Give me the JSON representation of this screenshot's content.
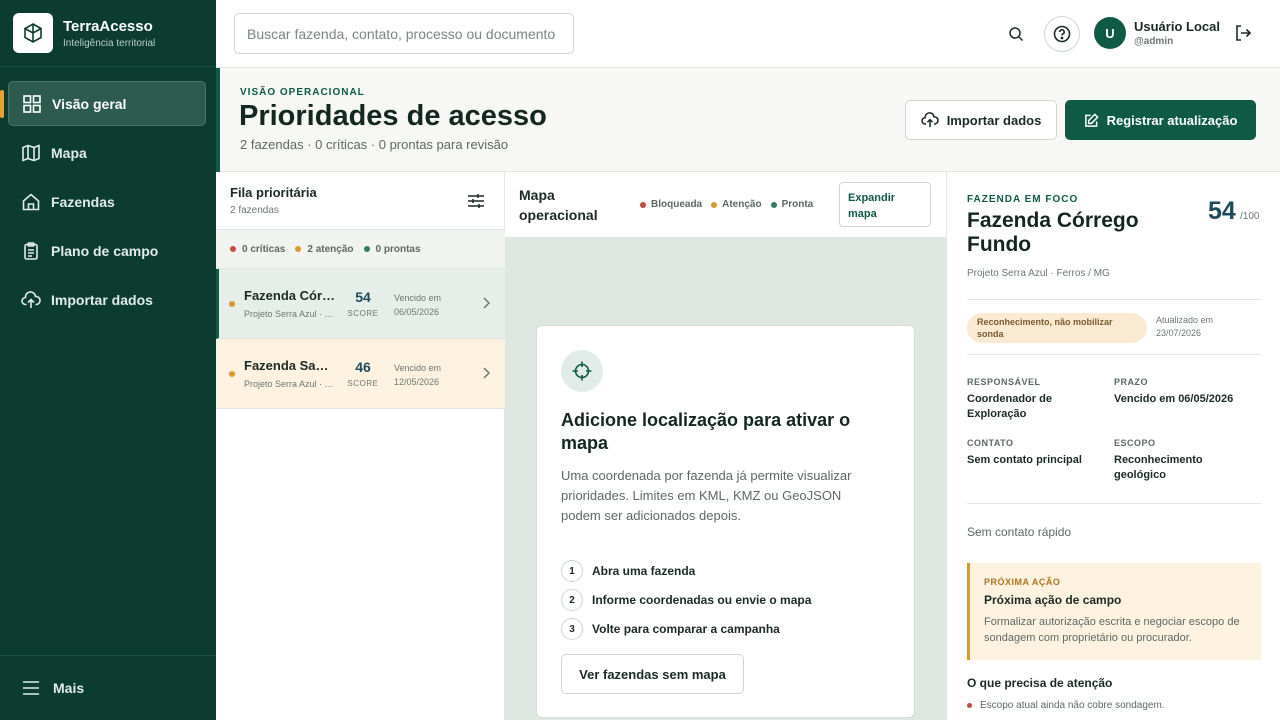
{
  "brand": {
    "name": "TerraAcesso",
    "subtitle": "Inteligência territorial"
  },
  "sidebar": {
    "items": [
      {
        "label": "Visão geral",
        "icon": "dashboard-icon",
        "active": true
      },
      {
        "label": "Mapa",
        "icon": "map-icon"
      },
      {
        "label": "Fazendas",
        "icon": "home-icon"
      },
      {
        "label": "Plano de campo",
        "icon": "clipboard-icon"
      },
      {
        "label": "Importar dados",
        "icon": "cloud-upload-icon"
      }
    ],
    "more_label": "Mais"
  },
  "topbar": {
    "search_placeholder": "Buscar fazenda, contato, processo ou documento",
    "avatar_initial": "U",
    "user_name": "Usuário Local",
    "user_handle": "@admin"
  },
  "header": {
    "eyebrow": "VISÃO OPERACIONAL",
    "title": "Prioridades de acesso",
    "subtitle": "2 fazendas · 0 críticas · 0 prontas para revisão",
    "import_label": "Importar dados",
    "register_label": "Registrar atualização"
  },
  "queue": {
    "title": "Fila prioritária",
    "count": "2 fazendas",
    "stats": [
      {
        "label": "0 críticas",
        "color": "#c9473d"
      },
      {
        "label": "2 atenção",
        "color": "#d9992f"
      },
      {
        "label": "0 prontas",
        "color": "#2f7d5b"
      }
    ],
    "rows": [
      {
        "name": "Fazenda Córrego Fundo",
        "project": "Projeto Serra Azul · Ferros / MG",
        "score": "54",
        "score_label": "SCORE",
        "due_label": "Vencido em",
        "due_date": "06/05/2026",
        "status_color": "#d9992f"
      },
      {
        "name": "Fazenda Santa Rita",
        "project": "Projeto Serra Azul · Ferros / MG",
        "score": "46",
        "score_label": "SCORE",
        "due_label": "Vencido em",
        "due_date": "12/05/2026",
        "status_color": "#d9992f"
      }
    ]
  },
  "map": {
    "title": "Mapa operacional",
    "legend": [
      {
        "label": "Bloqueada",
        "color": "#c9473d"
      },
      {
        "label": "Atenção",
        "color": "#d9992f"
      },
      {
        "label": "Pronta",
        "color": "#2f7d5b"
      }
    ],
    "expand_label": "Expandir mapa",
    "card": {
      "title": "Adicione localização para ativar o mapa",
      "text": "Uma coordenada por fazenda já permite visualizar prioridades. Limites em KML, KMZ ou GeoJSON podem ser adicionados depois.",
      "steps": [
        {
          "num": "1",
          "label": "Abra uma fazenda"
        },
        {
          "num": "2",
          "label": "Informe coordenadas ou envie o mapa"
        },
        {
          "num": "3",
          "label": "Volte para comparar a campanha"
        }
      ],
      "button_label": "Ver fazendas sem mapa"
    }
  },
  "detail": {
    "eyebrow": "FAZENDA EM FOCO",
    "title": "Fazenda Córrego Fundo",
    "score": "54",
    "score_max": "/100",
    "location": "Projeto Serra Azul · Ferros / MG",
    "badge": "Reconhecimento, não mobilizar sonda",
    "updated_label": "Atualizado em",
    "updated_date": "23/07/2026",
    "fields": {
      "responsavel_label": "RESPONSÁVEL",
      "responsavel_value": "Coordenador de Exploração",
      "prazo_label": "PRAZO",
      "prazo_value": "Vencido em 06/05/2026",
      "contato_label": "CONTATO",
      "contato_value": "Sem contato principal",
      "escopo_label": "ESCOPO",
      "escopo_value": "Reconhecimento geológico"
    },
    "quick_contact": "Sem contato rápido",
    "next_action": {
      "eyebrow": "PRÓXIMA AÇÃO",
      "title": "Próxima ação de campo",
      "text": "Formalizar autorização escrita e negociar escopo de sondagem com proprietário ou procurador."
    },
    "attention": {
      "title": "O que precisa de atenção",
      "item": "Escopo atual ainda não cobre sondagem.",
      "item_color": "#c9473d"
    }
  },
  "colors": {
    "primary": "#0f5a45",
    "sidebar": "#0c3b30",
    "accent": "#e0a23c"
  }
}
